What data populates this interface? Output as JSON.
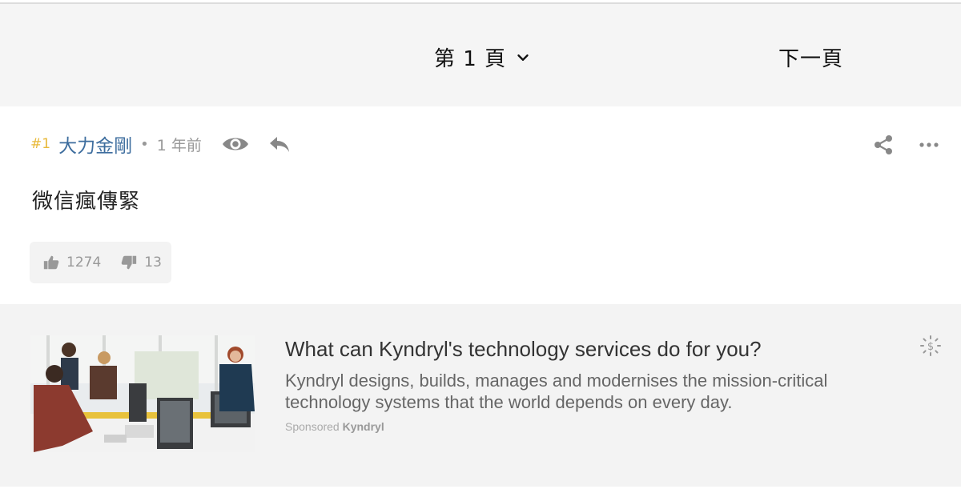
{
  "pager": {
    "page_label": "第 1 頁",
    "next_label": "下一頁"
  },
  "post": {
    "floor": "#1",
    "username": "大力金剛",
    "separator": "•",
    "time": "1 年前",
    "content": "微信瘋傳緊",
    "likes": "1274",
    "dislikes": "13"
  },
  "ad": {
    "title": "What can Kyndryl's technology services do for you?",
    "description": "Kyndryl designs, builds, manages and modernises the mission-critical technology systems that the world depends on every day.",
    "sponsored_label": "Sponsored",
    "sponsor_name": "Kyndryl"
  },
  "icons": {
    "chevron": "chevron-down-icon",
    "eye": "eye-icon",
    "reply": "reply-icon",
    "share": "share-icon",
    "more": "more-icon",
    "like": "thumbs-up-icon",
    "dislike": "thumbs-down-icon",
    "ad_choice": "ad-choice-icon"
  },
  "colors": {
    "floor": "#e8b93a",
    "username": "#3d6d9e",
    "pager_bg": "#f5f5f5",
    "ad_bg": "#f3f3f3"
  }
}
